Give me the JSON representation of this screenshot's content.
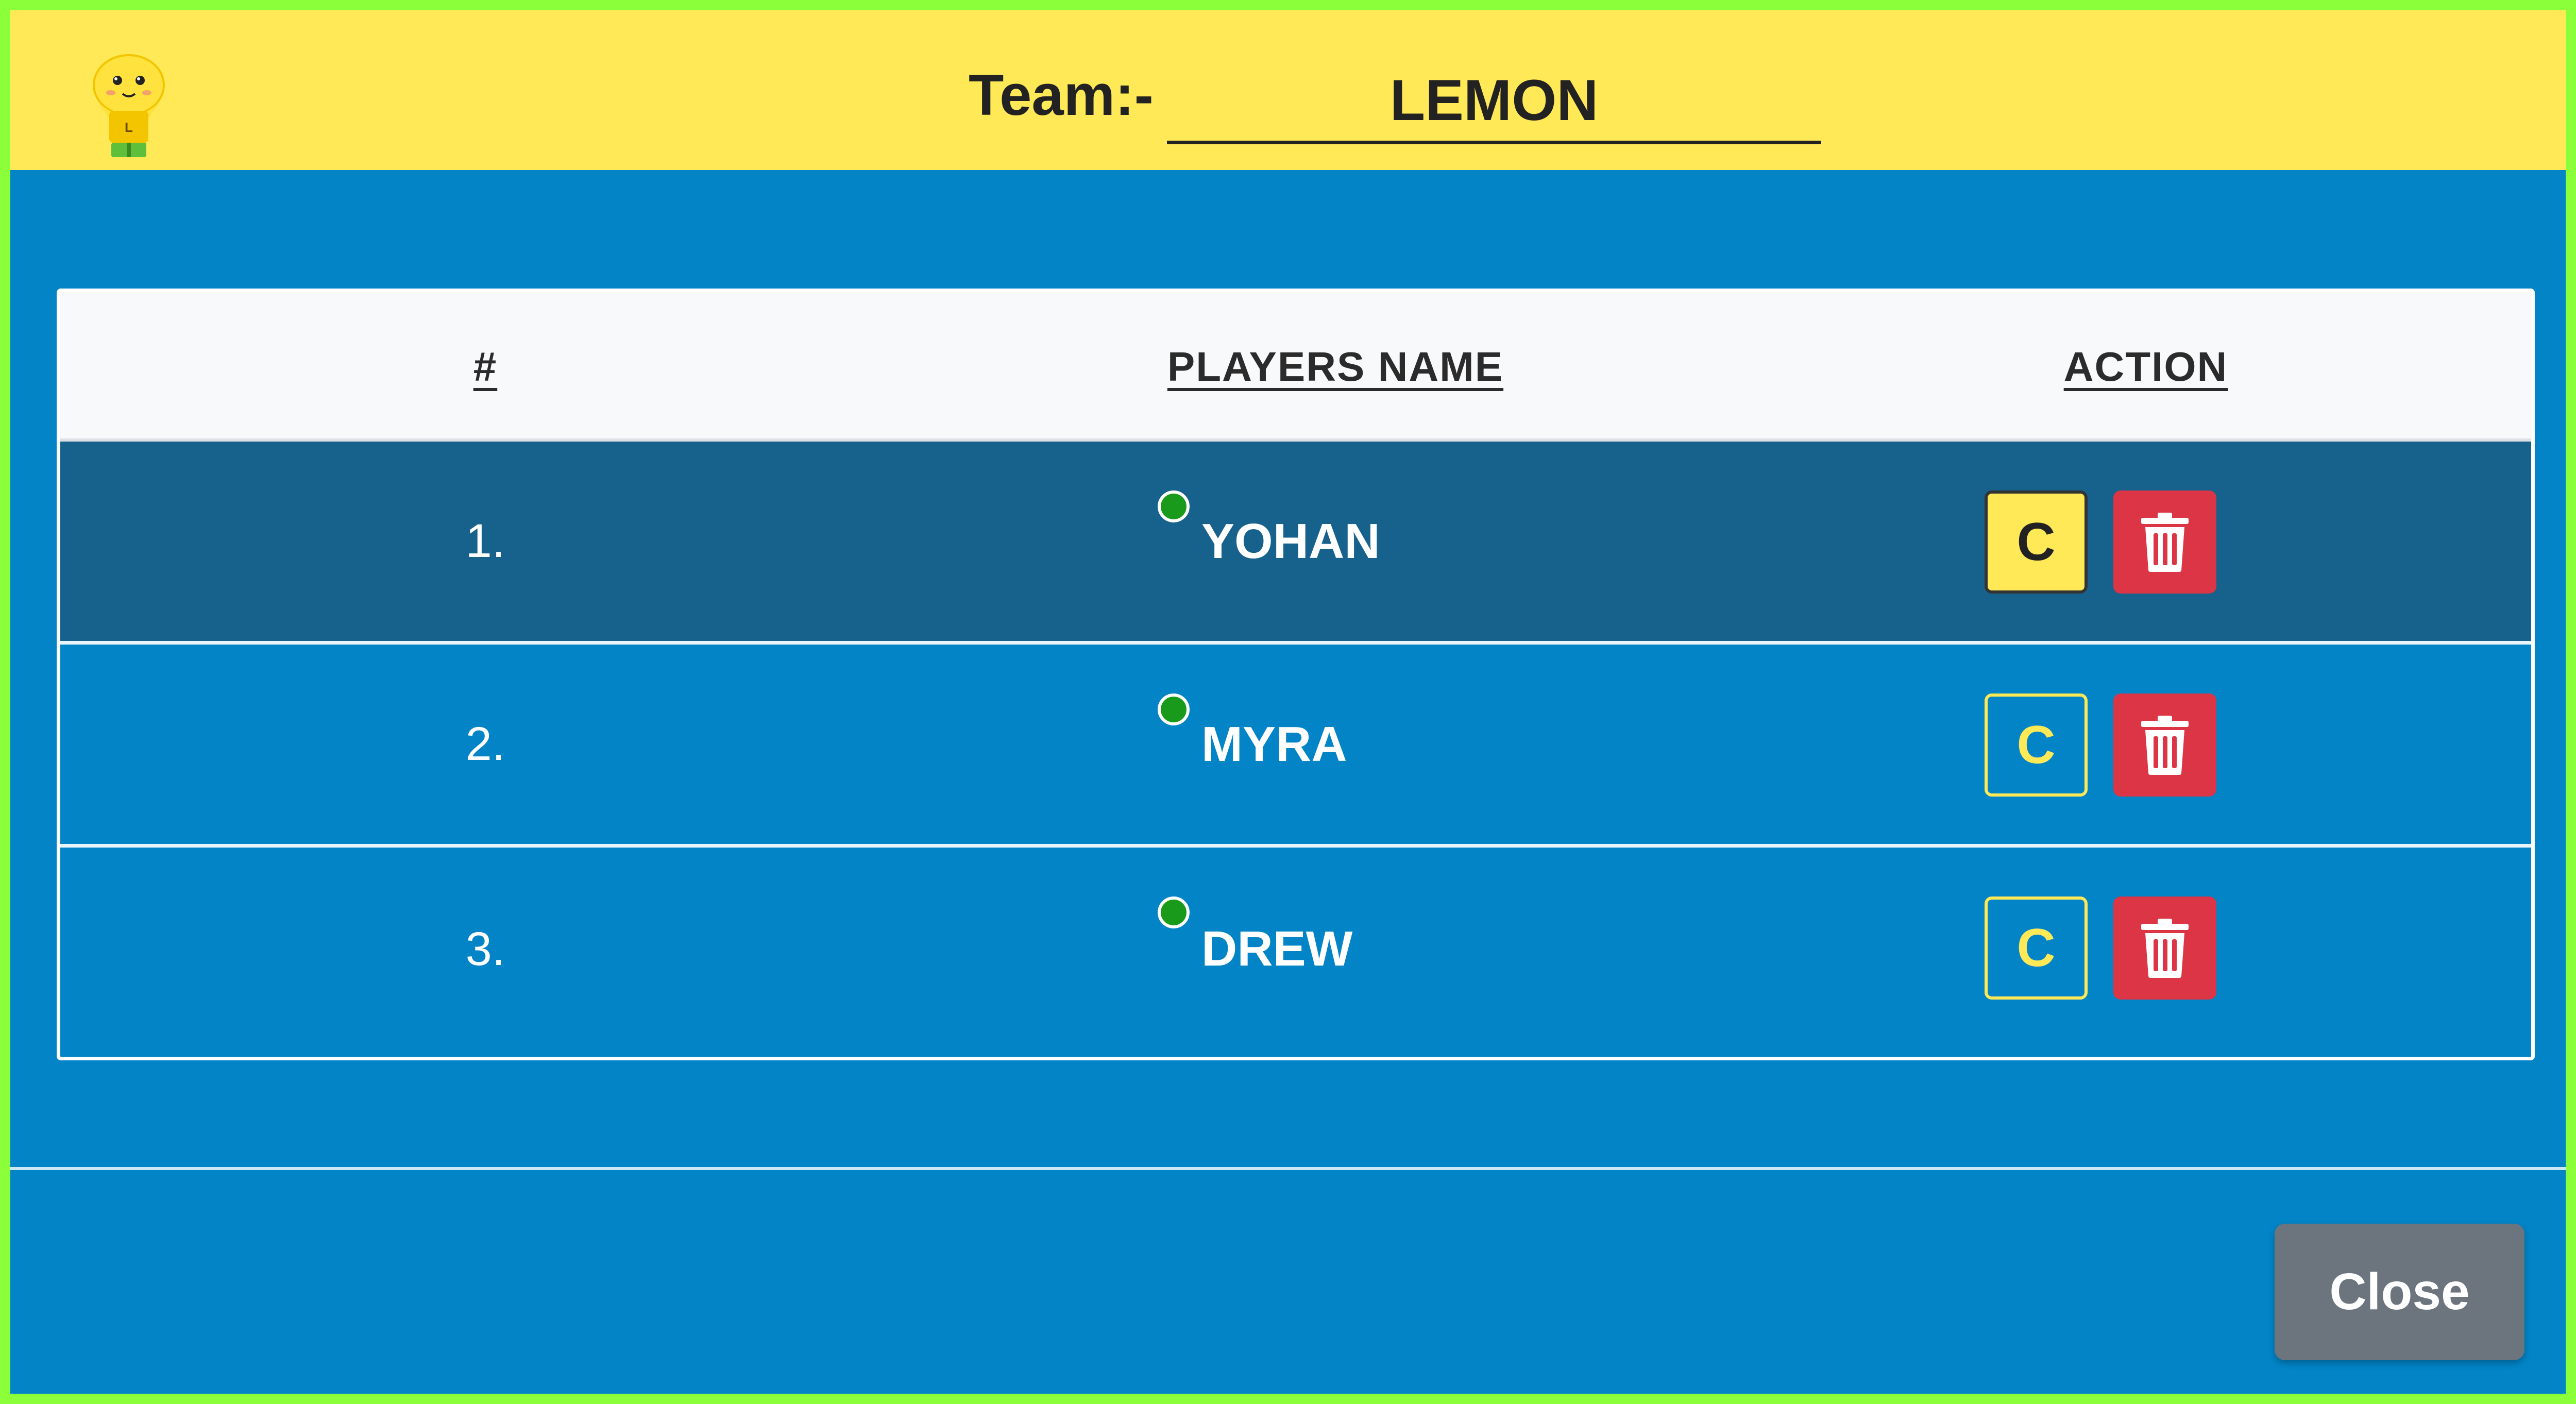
{
  "header": {
    "team_label": "Team:-",
    "team_name": "LEMON",
    "logo_icon": "lemon-mascot-icon",
    "background": "#ffe957"
  },
  "table": {
    "headers": {
      "number": "#",
      "name": "PLAYERS NAME",
      "action": "ACTION"
    },
    "rows": [
      {
        "index": "1.",
        "name": "YOHAN",
        "status": "online",
        "captain": true,
        "captain_label": "C"
      },
      {
        "index": "2.",
        "name": "MYRA",
        "status": "online",
        "captain": false,
        "captain_label": "C"
      },
      {
        "index": "3.",
        "name": "DREW",
        "status": "online",
        "captain": false,
        "captain_label": "C"
      }
    ]
  },
  "footer": {
    "close_label": "Close"
  },
  "colors": {
    "frame_border": "#8bff3a",
    "modal_background": "#0284c7",
    "active_row": "#17628d",
    "captain_yellow": "#ffe957",
    "delete_red": "#dc3545",
    "online_green": "#1a9a1a",
    "close_gray": "#6c757d"
  }
}
